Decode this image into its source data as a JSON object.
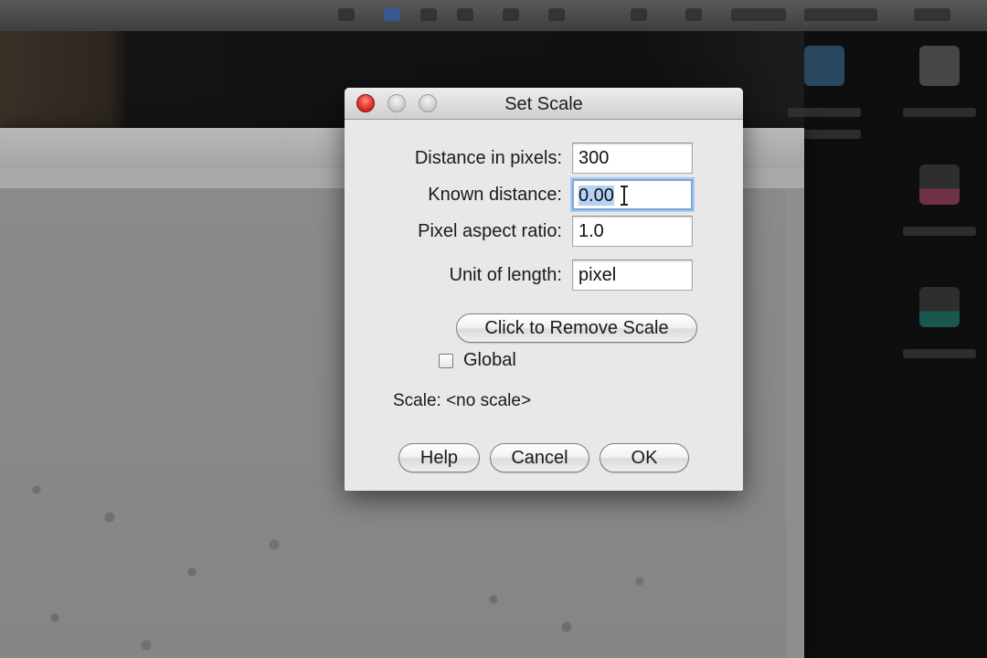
{
  "dialog": {
    "title": "Set Scale"
  },
  "fields": [
    {
      "label": "Distance in pixels:",
      "value": "300"
    },
    {
      "label": "Known distance:",
      "value": "0.00"
    },
    {
      "label": "Pixel aspect ratio:",
      "value": "1.0"
    },
    {
      "label": "Unit of length:",
      "value": "pixel"
    }
  ],
  "remove_scale_button": "Click to Remove Scale",
  "global_checkbox": {
    "label": "Global",
    "checked": false
  },
  "scale_status": "Scale: <no scale>",
  "buttons": {
    "help": "Help",
    "cancel": "Cancel",
    "ok": "OK"
  },
  "colors": {
    "close_button": "#e0332b",
    "focus_ring": "#7aa7d9",
    "selection": "#b4d2f5"
  }
}
